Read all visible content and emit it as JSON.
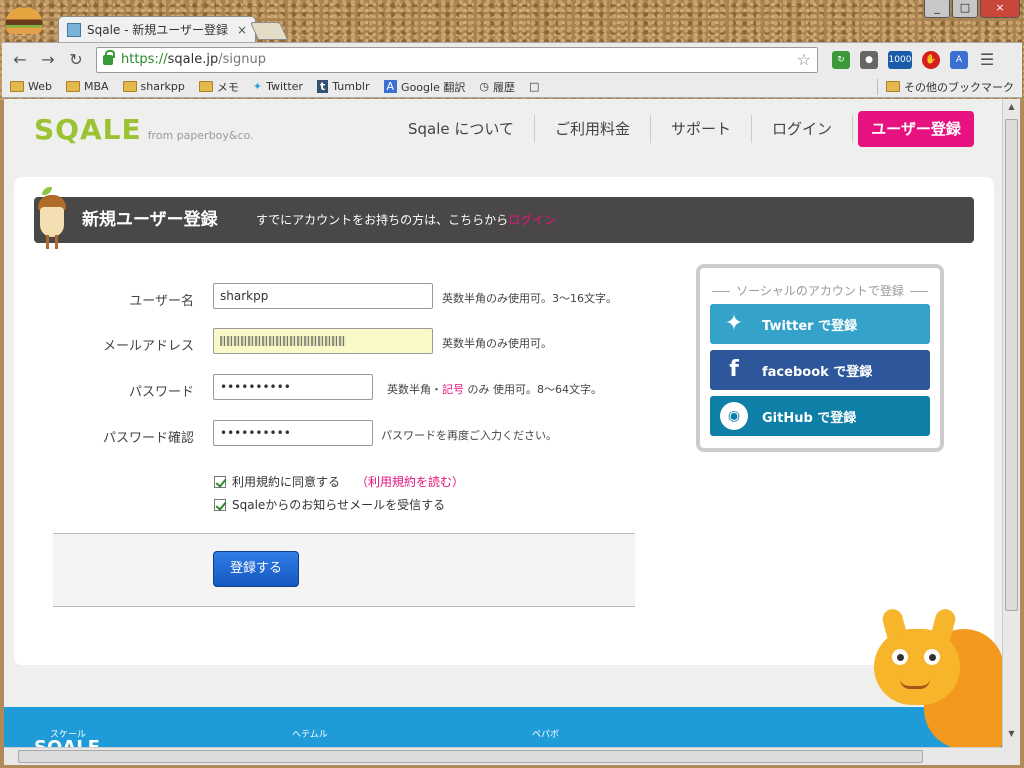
{
  "browser": {
    "tab_title": "Sqale - 新規ユーザー登録",
    "tab_close": "×",
    "url_scheme": "https://",
    "url_host": "sqale.jp",
    "url_path": "/signup",
    "badge_count": "1000",
    "window_controls": [
      "_",
      "□",
      "×"
    ],
    "bookmarks": [
      {
        "label": "Web",
        "icon": "folder-icon"
      },
      {
        "label": "MBA",
        "icon": "folder-icon"
      },
      {
        "label": "sharkpp",
        "icon": "folder-icon"
      },
      {
        "label": "メモ",
        "icon": "folder-icon"
      },
      {
        "label": "Twitter",
        "icon": "twitter-icon"
      },
      {
        "label": "Tumblr",
        "icon": "tumblr-icon"
      },
      {
        "label": "Google 翻訳",
        "icon": "translate-icon"
      },
      {
        "label": "履歴",
        "icon": "history-icon"
      }
    ],
    "other_bookmarks": "その他のブックマーク"
  },
  "site": {
    "logo": "SQALE",
    "logo_from": "from paperboy&co.",
    "nav": [
      "Sqale について",
      "ご利用料金",
      "サポート",
      "ログイン"
    ],
    "signup_button": "ユーザー登録"
  },
  "form": {
    "title": "新規ユーザー登録",
    "subtitle_prefix": "すでにアカウントをお持ちの方は、こちらから",
    "subtitle_link": "ログイン",
    "fields": [
      {
        "label": "ユーザー名",
        "value": "sharkpp",
        "hint": "英数半角のみ使用可。3〜16文字。"
      },
      {
        "label": "メールアドレス",
        "value": "",
        "hint": "英数半角のみ使用可。"
      },
      {
        "label": "パスワード",
        "value": "••••••••••",
        "hint_a": "英数半角・",
        "hint_link": "記号",
        "hint_b": " のみ 使用可。8〜64文字。"
      },
      {
        "label": "パスワード確認",
        "value": "••••••••••",
        "hint": "パスワードを再度ご入力ください。"
      }
    ],
    "checkbox_terms": "利用規約に同意する",
    "terms_link": "（利用規約を読む）",
    "checkbox_newsletter": "Sqaleからのお知らせメールを受信する",
    "submit": "登録する"
  },
  "social": {
    "caption": "ソーシャルのアカウントで登録",
    "twitter": "Twitter で登録",
    "facebook": "facebook で登録",
    "github": "GitHub で登録"
  },
  "footer": {
    "small1": "スケール",
    "small2": "ヘテムル",
    "small3": "ペパボ"
  },
  "colors": {
    "brand_green": "#9ac232",
    "accent_pink": "#e6127f",
    "twitter": "#35a3c9",
    "facebook": "#2d579a",
    "github": "#0e7fa6",
    "footer_blue": "#1f9bd7"
  }
}
